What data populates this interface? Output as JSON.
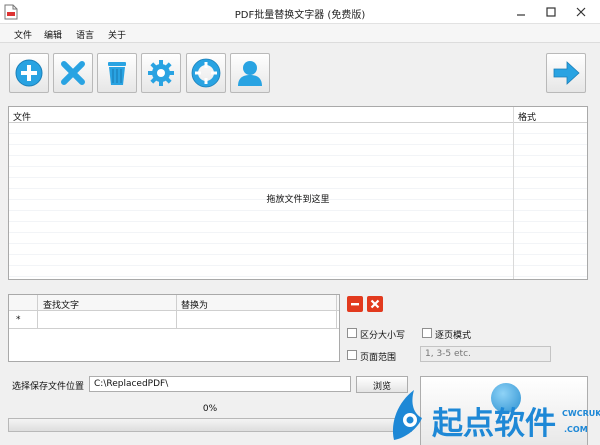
{
  "window": {
    "title": "PDF批量替换文字器 (免费版)"
  },
  "menu": [
    "文件",
    "编辑",
    "语言",
    "关于"
  ],
  "toolbar": {
    "icons": [
      "add-icon",
      "remove-icon",
      "trash-icon",
      "gear-icon",
      "lifebuoy-icon",
      "user-icon",
      "arrow-right-icon"
    ],
    "colors": {
      "accent": "#29a3e2",
      "icon_gray": "#555555"
    }
  },
  "file_list": {
    "columns": [
      "文件",
      "格式"
    ],
    "drop_hint": "拖放文件到这里"
  },
  "replace_table": {
    "columns": [
      "查找文字",
      "替换为"
    ],
    "new_row_marker": "*"
  },
  "options": {
    "case_sensitive": {
      "label": "区分大小写",
      "checked": false
    },
    "page_mode": {
      "label": "逐页模式",
      "checked": false
    },
    "page_range": {
      "label": "页面范围",
      "checked": false,
      "placeholder": "1, 3-5 etc."
    }
  },
  "save": {
    "label": "选择保存文件位置",
    "path": "C:\\ReplacedPDF\\",
    "browse_label": "浏览"
  },
  "progress": {
    "text": "0%",
    "value": 0
  },
  "watermark": {
    "text_main": "起点软件",
    "text_sub1": "CWCRUK",
    "text_sub2": ".COM"
  }
}
